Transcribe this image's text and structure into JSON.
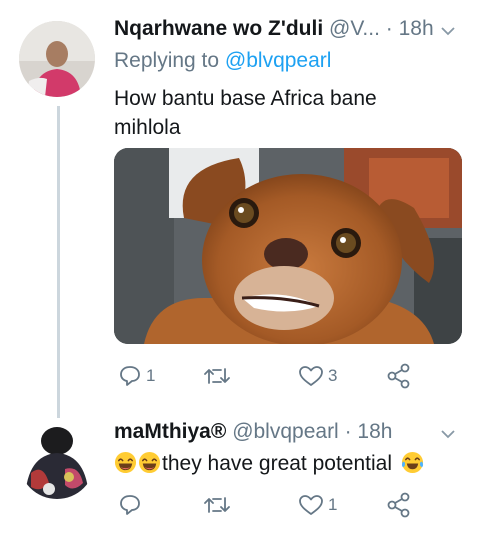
{
  "tweet1": {
    "name": "Nqarhwane wo Z'duli",
    "handle": "@V...",
    "dot": "·",
    "time": "18h",
    "replying_prefix": "Replying to",
    "replying_to": "@blvqpearl",
    "text_line1": "How bantu base Africa bane",
    "text_line2": "mihlola",
    "reply_count": "1",
    "retweet_count": "",
    "like_count": "3"
  },
  "tweet2": {
    "name": "maMthiya®",
    "handle": "@blvqpearl",
    "dot": "·",
    "time": "18h",
    "text": "they have great potential",
    "reply_count": "",
    "retweet_count": "",
    "like_count": "1"
  },
  "icons": {
    "reply": "reply-icon",
    "retweet": "retweet-icon",
    "like": "heart-icon",
    "share": "share-icon",
    "more": "chevron-down-icon"
  },
  "colors": {
    "link": "#1da1f2",
    "secondary": "#657786",
    "thread_line": "#ccd6dd"
  }
}
